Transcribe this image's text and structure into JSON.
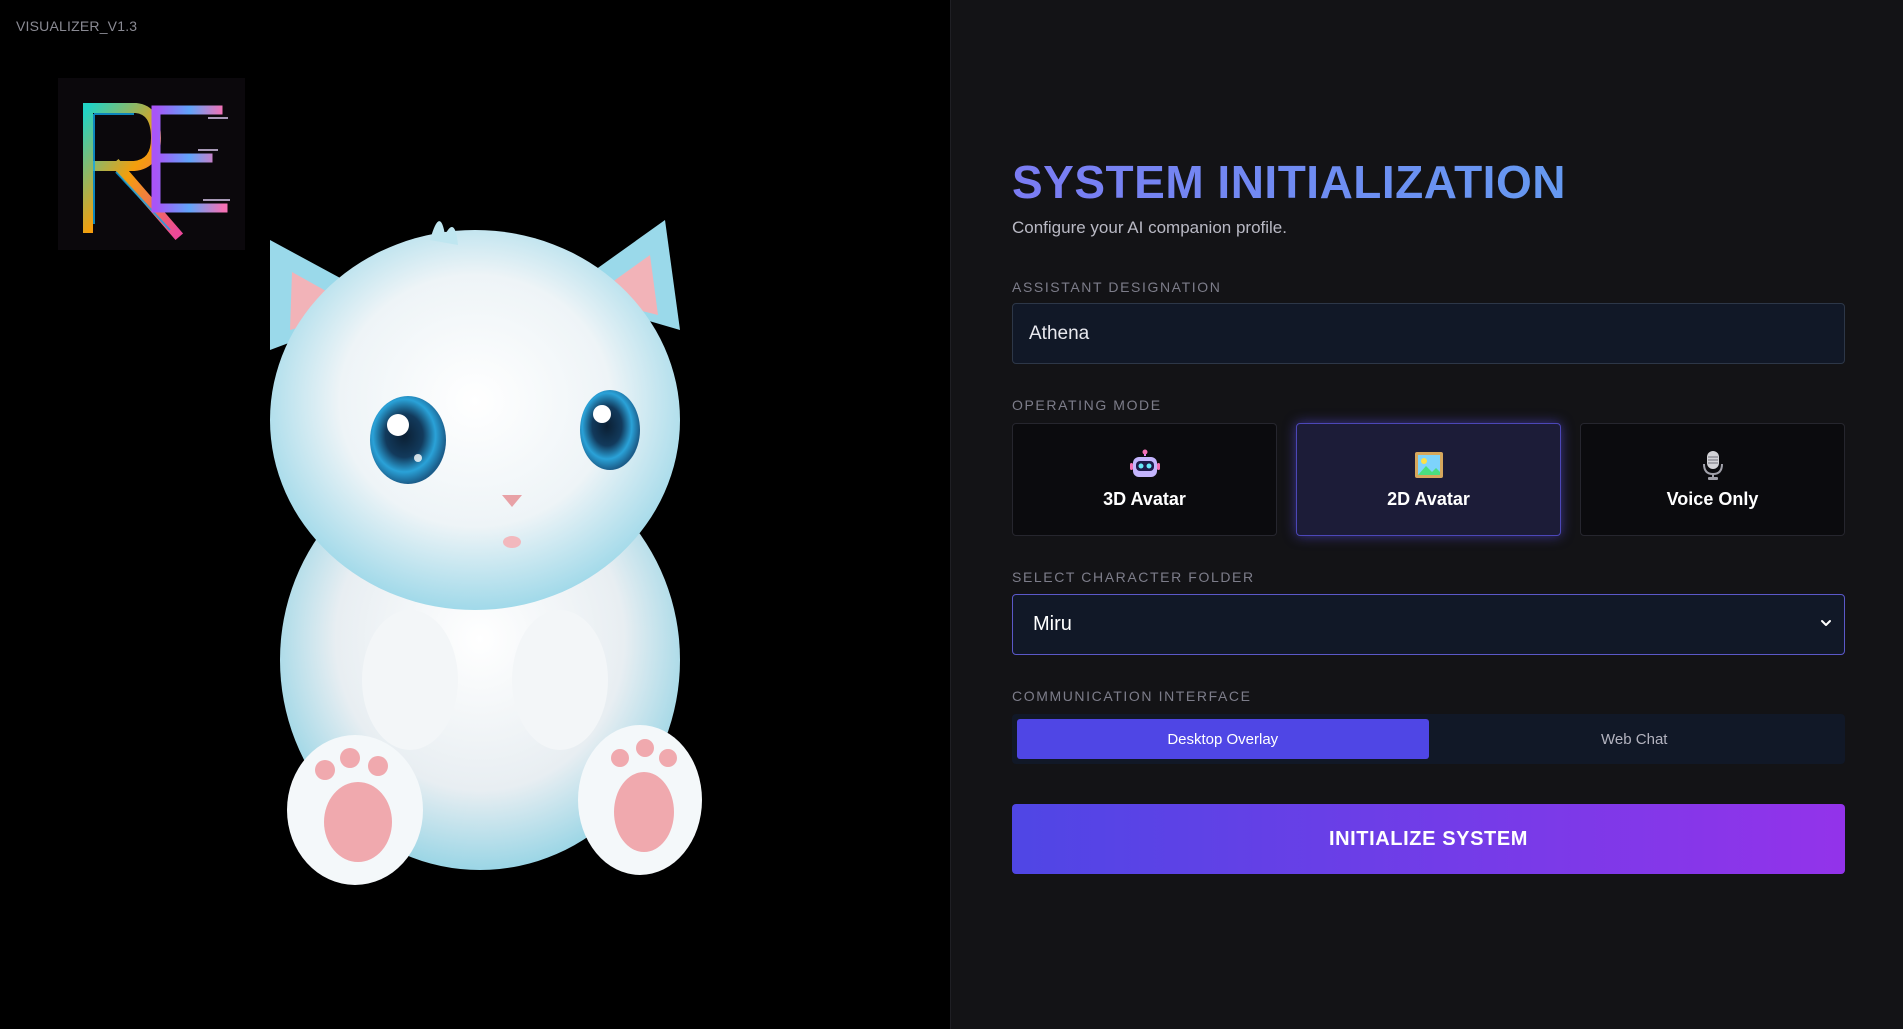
{
  "app": {
    "version": "VISUALIZER_V1.3"
  },
  "logo": {
    "text": "RE",
    "icon": "re-glitch-logo"
  },
  "mascot": {
    "icon": "fluffy-blue-cat-character"
  },
  "header": {
    "title": "SYSTEM INITIALIZATION",
    "subtitle": "Configure your AI companion profile."
  },
  "fields": {
    "designation": {
      "label": "ASSISTANT DESIGNATION",
      "value": "Athena"
    },
    "mode": {
      "label": "OPERATING MODE",
      "options": [
        {
          "label": "3D Avatar",
          "icon": "robot-icon",
          "active": false
        },
        {
          "label": "2D Avatar",
          "icon": "picture-icon",
          "active": true
        },
        {
          "label": "Voice Only",
          "icon": "microphone-icon",
          "active": false
        }
      ]
    },
    "folder": {
      "label": "SELECT CHARACTER FOLDER",
      "selected": "Miru"
    },
    "interface": {
      "label": "COMMUNICATION INTERFACE",
      "options": [
        {
          "label": "Desktop Overlay",
          "active": true
        },
        {
          "label": "Web Chat",
          "active": false
        }
      ]
    }
  },
  "actions": {
    "initialize_label": "INITIALIZE SYSTEM"
  },
  "colors": {
    "accent": "#4f46e5",
    "accent_end": "#9333ea",
    "title_start": "#7b7cf3",
    "title_end": "#5aa8f0",
    "panel_bg": "#131316",
    "field_bg": "#111827"
  }
}
